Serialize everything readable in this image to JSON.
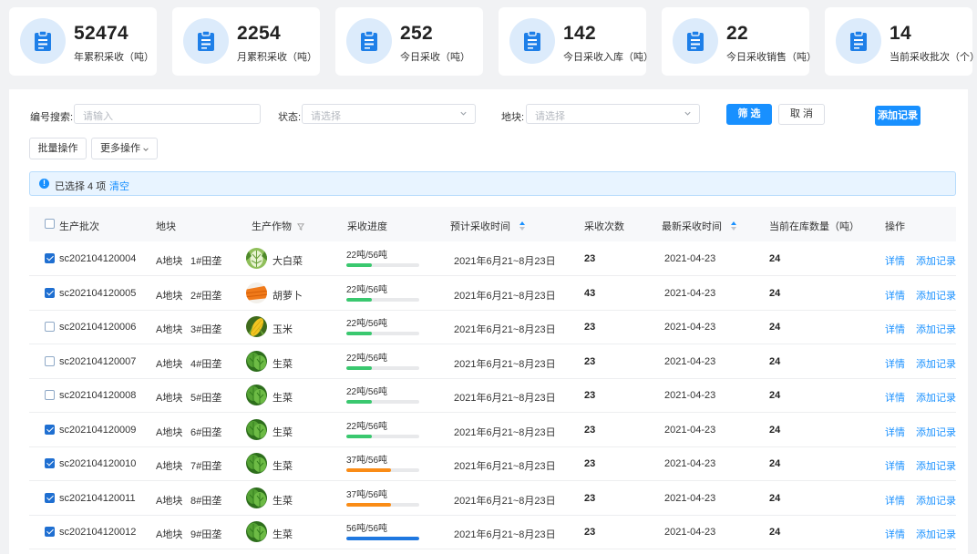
{
  "stats": [
    {
      "value": "52474",
      "label": "年累积采收（吨）",
      "icon": "clipboard-icon"
    },
    {
      "value": "2254",
      "label": "月累积采收（吨）",
      "icon": "clipboard-icon"
    },
    {
      "value": "252",
      "label": "今日采收（吨）",
      "icon": "clipboard-icon"
    },
    {
      "value": "142",
      "label": "今日采收入库（吨）",
      "icon": "clipboard-icon"
    },
    {
      "value": "22",
      "label": "今日采收销售（吨）",
      "icon": "clipboard-icon"
    },
    {
      "value": "14",
      "label": "当前采收批次（个）",
      "icon": "clipboard-icon"
    }
  ],
  "filters": {
    "code_label": "编号搜索:",
    "code_placeholder": "请输入",
    "status_label": "状态:",
    "status_placeholder": "请选择",
    "plot_label": "地块:",
    "plot_placeholder": "请选择",
    "filter_button": "筛 选",
    "cancel_button": "取 消",
    "add_button": "添加记录"
  },
  "toolbar": {
    "batch_label": "批量操作",
    "more_label": "更多操作"
  },
  "alert": {
    "text": "已选择 4 项",
    "clear": "清空"
  },
  "table": {
    "headers": {
      "batch": "生产批次",
      "plot": "地块",
      "crop": "生产作物",
      "progress": "采收进度",
      "expected": "预计采收时间",
      "count": "采收次数",
      "latest": "最新采收时间",
      "stock": "当前在库数量（吨）",
      "actions": "操作"
    },
    "detail_label": "详情",
    "add_label": "添加记录",
    "rows": [
      {
        "checked": true,
        "batch": "sc202104120004",
        "plot": "A地块",
        "field": "1#田垄",
        "crop": "大白菜",
        "crop_icon": "cabbage",
        "progress_text": "22吨/56吨",
        "progress": 0.35,
        "progress_color": "#3ac86f",
        "expected": "2021年6月21~8月23日",
        "count": "23",
        "latest": "2021-04-23",
        "stock": "24"
      },
      {
        "checked": true,
        "batch": "sc202104120005",
        "plot": "A地块",
        "field": "2#田垄",
        "crop": "胡萝卜",
        "crop_icon": "carrot",
        "progress_text": "22吨/56吨",
        "progress": 0.35,
        "progress_color": "#3ac86f",
        "expected": "2021年6月21~8月23日",
        "count": "43",
        "latest": "2021-04-23",
        "stock": "24"
      },
      {
        "checked": false,
        "batch": "sc202104120006",
        "plot": "A地块",
        "field": "3#田垄",
        "crop": "玉米",
        "crop_icon": "corn",
        "progress_text": "22吨/56吨",
        "progress": 0.35,
        "progress_color": "#3ac86f",
        "expected": "2021年6月21~8月23日",
        "count": "23",
        "latest": "2021-04-23",
        "stock": "24"
      },
      {
        "checked": false,
        "batch": "sc202104120007",
        "plot": "A地块",
        "field": "4#田垄",
        "crop": "生菜",
        "crop_icon": "lettuce",
        "progress_text": "22吨/56吨",
        "progress": 0.35,
        "progress_color": "#3ac86f",
        "expected": "2021年6月21~8月23日",
        "count": "23",
        "latest": "2021-04-23",
        "stock": "24"
      },
      {
        "checked": false,
        "batch": "sc202104120008",
        "plot": "A地块",
        "field": "5#田垄",
        "crop": "生菜",
        "crop_icon": "lettuce",
        "progress_text": "22吨/56吨",
        "progress": 0.35,
        "progress_color": "#3ac86f",
        "expected": "2021年6月21~8月23日",
        "count": "23",
        "latest": "2021-04-23",
        "stock": "24"
      },
      {
        "checked": true,
        "batch": "sc202104120009",
        "plot": "A地块",
        "field": "6#田垄",
        "crop": "生菜",
        "crop_icon": "lettuce",
        "progress_text": "22吨/56吨",
        "progress": 0.35,
        "progress_color": "#3ac86f",
        "expected": "2021年6月21~8月23日",
        "count": "23",
        "latest": "2021-04-23",
        "stock": "24"
      },
      {
        "checked": true,
        "batch": "sc202104120010",
        "plot": "A地块",
        "field": "7#田垄",
        "crop": "生菜",
        "crop_icon": "lettuce",
        "progress_text": "37吨/56吨",
        "progress": 0.61,
        "progress_color": "#fa8c16",
        "expected": "2021年6月21~8月23日",
        "count": "23",
        "latest": "2021-04-23",
        "stock": "24"
      },
      {
        "checked": true,
        "batch": "sc202104120011",
        "plot": "A地块",
        "field": "8#田垄",
        "crop": "生菜",
        "crop_icon": "lettuce",
        "progress_text": "37吨/56吨",
        "progress": 0.61,
        "progress_color": "#fa8c16",
        "expected": "2021年6月21~8月23日",
        "count": "23",
        "latest": "2021-04-23",
        "stock": "24"
      },
      {
        "checked": true,
        "batch": "sc202104120012",
        "plot": "A地块",
        "field": "9#田垄",
        "crop": "生菜",
        "crop_icon": "lettuce",
        "progress_text": "56吨/56吨",
        "progress": 1.0,
        "progress_color": "#1f78e0",
        "expected": "2021年6月21~8月23日",
        "count": "23",
        "latest": "2021-04-23",
        "stock": "24"
      }
    ]
  }
}
